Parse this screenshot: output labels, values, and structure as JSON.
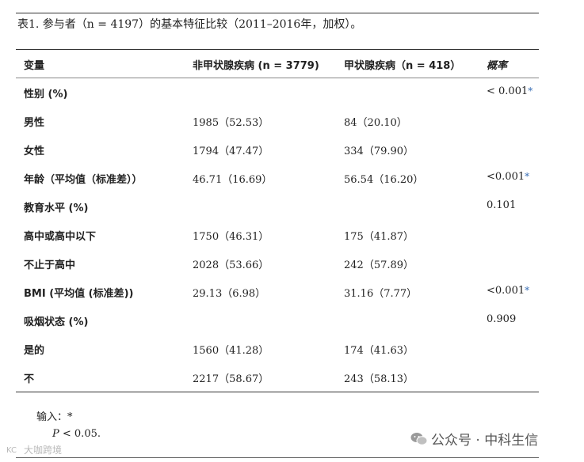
{
  "caption": "表1. 参与者（n = 4197）的基本特征比较（2011–2016年，加权）。",
  "headers": [
    "变量",
    "非甲状腺疾病 (n = 3779)",
    "甲状腺疾病（n = 418）",
    "概率"
  ],
  "rows": [
    {
      "label": "性别 (%)",
      "c1": "",
      "c2": "",
      "p": "< 0.001",
      "star": "*"
    },
    {
      "label": "男性",
      "c1": "1985（52.53）",
      "c2": "84（20.10）",
      "p": "",
      "star": ""
    },
    {
      "label": "女性",
      "c1": "1794（47.47）",
      "c2": "334（79.90）",
      "p": "",
      "star": ""
    },
    {
      "label": "年龄（平均值（标准差））",
      "c1": "46.71（16.69）",
      "c2": "56.54（16.20）",
      "p": "<0.001",
      "star": "*"
    },
    {
      "label": "教育水平 (%)",
      "c1": "",
      "c2": "",
      "p": "0.101",
      "star": ""
    },
    {
      "label": "高中或高中以下",
      "c1": "1750（46.31）",
      "c2": "175（41.87）",
      "p": "",
      "star": ""
    },
    {
      "label": "不止于高中",
      "c1": "2028（53.66）",
      "c2": "242（57.89）",
      "p": "",
      "star": ""
    },
    {
      "label": "BMI (平均值 (标准差))",
      "c1": "29.13（6.98）",
      "c2": "31.16（7.77）",
      "p": "<0.001",
      "star": "*"
    },
    {
      "label": "吸烟状态 (%)",
      "c1": "",
      "c2": "",
      "p": "0.909",
      "star": ""
    },
    {
      "label": "是的",
      "c1": "1560（41.28）",
      "c2": "174（41.63）",
      "p": "",
      "star": ""
    },
    {
      "label": "不",
      "c1": "2217（58.67）",
      "c2": "243（58.13）",
      "p": "",
      "star": ""
    }
  ],
  "note": {
    "line1": "输入：*",
    "p_symbol": "P",
    "p_text": "< 0.05."
  },
  "watermarks": {
    "left": "大咖跨境",
    "right": "公众号 · 中科生信"
  }
}
